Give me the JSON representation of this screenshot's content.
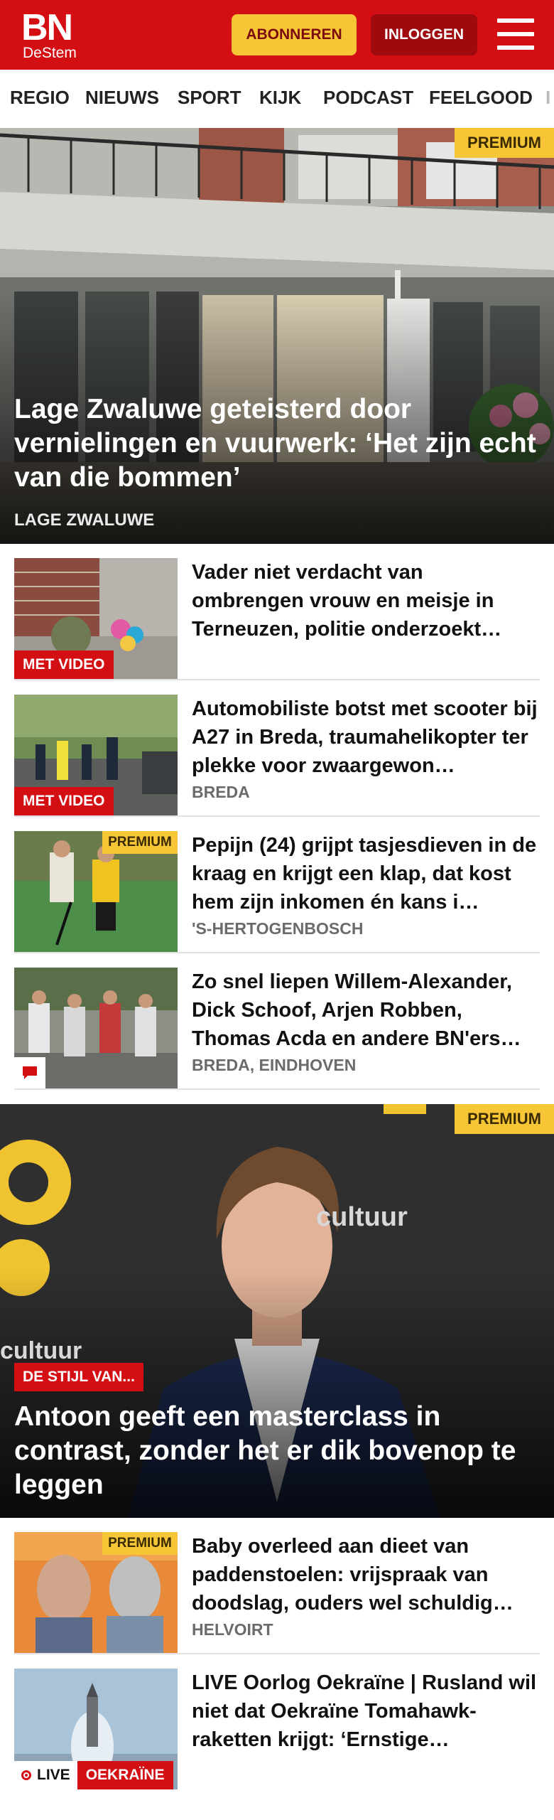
{
  "header": {
    "logo_main": "BN",
    "logo_sub": "DeStem",
    "subscribe_label": "ABONNEREN",
    "login_label": "INLOGGEN",
    "menu_icon": "hamburger-menu-icon"
  },
  "nav": {
    "items": [
      "REGIO",
      "NIEUWS",
      "SPORT",
      "KIJK",
      "PODCAST",
      "FEELGOOD",
      "I"
    ]
  },
  "hero1": {
    "badge": "PREMIUM",
    "title": "Lage Zwaluwe geteisterd door vernielingen en vuurwerk: ‘Het zijn echt van die bommen’",
    "location": "LAGE ZWALUWE"
  },
  "articles": [
    {
      "title": "Vader niet verdacht van ombrengen vrouw en meisje in Terneuzen, politie onderzoekt…",
      "location": "",
      "label": "MET VIDEO"
    },
    {
      "title": "Automobiliste botst met scooter bij A27 in Breda, traumahelikop­ter ter plekke voor zwaargewon…",
      "location": "BREDA",
      "label": "MET VIDEO"
    },
    {
      "title": "Pepijn (24) grijpt tasjesdieven in de kraag en krijgt een klap, dat kost hem zijn inkomen én kans i…",
      "location": "'S-HERTOGENBOSCH",
      "badge": "PREMIUM"
    },
    {
      "title": "Zo snel liepen Willem-Alexander, Dick Schoof, Arjen Robben, Thomas Acda en andere BN'ers…",
      "location": "BREDA, EINDHOVEN",
      "icon": "comment-icon"
    }
  ],
  "hero2": {
    "badge": "PREMIUM",
    "section_label": "DE STIJL VAN...",
    "title": "Antoon geeft een masterclass in contrast, zonder het er dik bovenop te leggen",
    "backdrop_text": "cultuur"
  },
  "articles2": [
    {
      "title": "Baby overleed aan dieet van paddenstoelen: vrijspraak van doodslag, ouders wel schuldig…",
      "location": "HELVOIRT",
      "badge": "PREMIUM"
    },
    {
      "title": "LIVE Oorlog Oekraïne | Rusland wil niet dat Oekraïne Tomahawk-raketten krijgt: ‘Ernstige…",
      "location": "",
      "live_label": "LIVE",
      "topic_label": "OEKRAÏNE"
    }
  ],
  "colors": {
    "brand_red": "#d40f14",
    "premium_yellow": "#f7c637",
    "login_dark_red": "#9e0a0e",
    "location_gray": "#6b6b6b"
  }
}
